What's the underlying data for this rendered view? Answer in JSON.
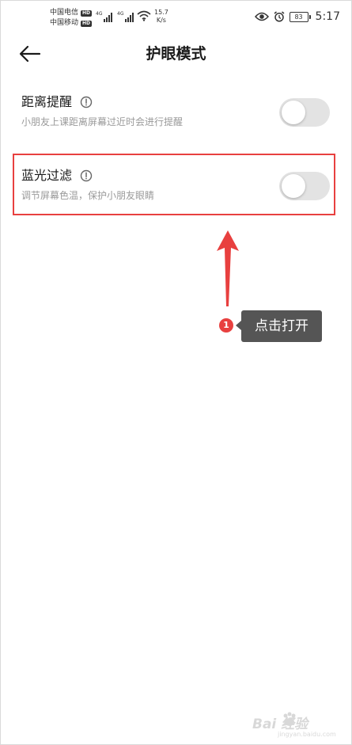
{
  "status_bar": {
    "carrier_1": "中国电信",
    "carrier_2": "中国移动",
    "hd_badge": "HD",
    "signal_tag": "4G",
    "net_speed_value": "15.7",
    "net_speed_unit": "K/s",
    "battery": "83",
    "time": "5:17",
    "icons": [
      "eye-icon",
      "alarm-icon",
      "wifi-icon",
      "signal-icon",
      "battery-icon"
    ]
  },
  "header": {
    "title": "护眼模式",
    "back_icon": "arrow-left-icon"
  },
  "settings": [
    {
      "title": "距离提醒",
      "description": "小朋友上课距离屏幕过近时会进行提醒",
      "enabled": false
    },
    {
      "title": "蓝光过滤",
      "description": "调节屏幕色温，保护小朋友眼睛",
      "enabled": false
    }
  ],
  "annotation": {
    "step_number": "1",
    "label": "点击打开",
    "accent_color": "#e8403f"
  },
  "watermark": {
    "text": "Bai 经验",
    "url": "jingyan.baidu.com"
  },
  "colors": {
    "toggle_off": "#e3e3e3",
    "description_text": "#9a9a9a",
    "tooltip_bg": "#555555"
  }
}
